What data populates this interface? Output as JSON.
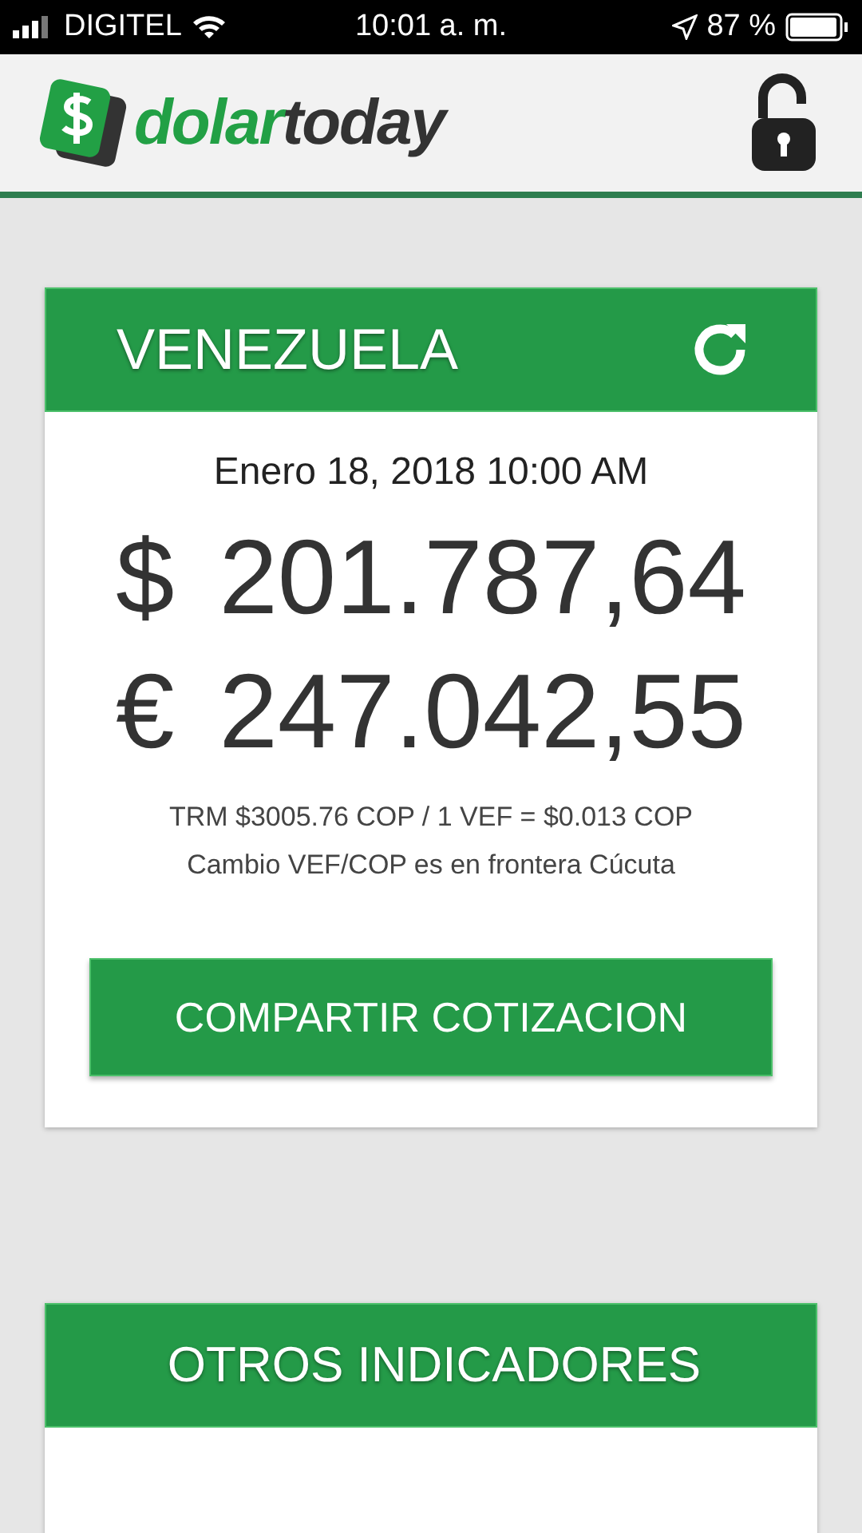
{
  "status_bar": {
    "carrier": "DIGITEL",
    "time": "10:01 a. m.",
    "battery": "87 %"
  },
  "header": {
    "logo_green": "dolar",
    "logo_dark": "today"
  },
  "rate_card": {
    "title": "VENEZUELA",
    "date": "Enero 18, 2018 10:00 AM",
    "rates": [
      {
        "symbol": "$",
        "value": "201.787,64"
      },
      {
        "symbol": "€",
        "value": "247.042,55"
      }
    ],
    "notes": [
      "TRM $3005.76 COP / 1 VEF = $0.013 COP",
      "Cambio VEF/COP es en frontera Cúcuta"
    ],
    "share_button": "COMPARTIR COTIZACION"
  },
  "other_card": {
    "title": "OTROS INDICADORES"
  }
}
